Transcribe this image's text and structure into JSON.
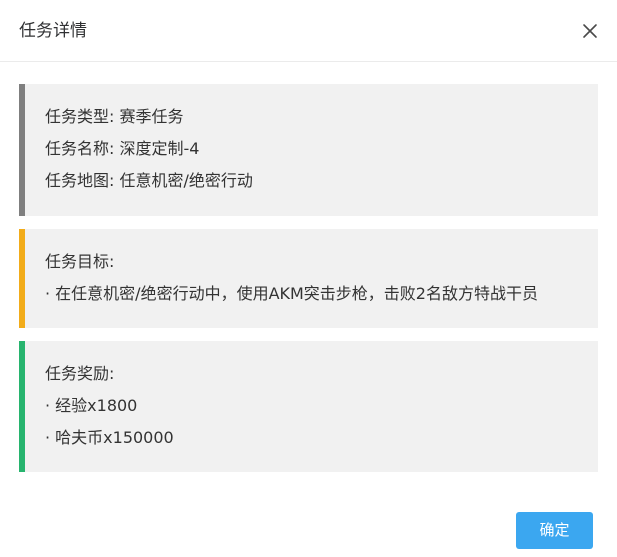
{
  "dialog": {
    "title": "任务详情",
    "confirm_label": "确定"
  },
  "info_card": {
    "accent_color": "#7f7f7f",
    "type_line": "任务类型: 赛季任务",
    "name_line": "任务名称: 深度定制-4",
    "map_line": "任务地图: 任意机密/绝密行动"
  },
  "goal_card": {
    "accent_color": "#f2ac1a",
    "heading": "任务目标:",
    "items": [
      "· 在任意机密/绝密行动中，使用AKM突击步枪，击败2名敌方特战干员"
    ]
  },
  "reward_card": {
    "accent_color": "#27b46e",
    "heading": "任务奖励:",
    "items": [
      "· 经验x1800",
      "· 哈夫币x150000"
    ]
  },
  "icons": {
    "close": "close-icon"
  }
}
